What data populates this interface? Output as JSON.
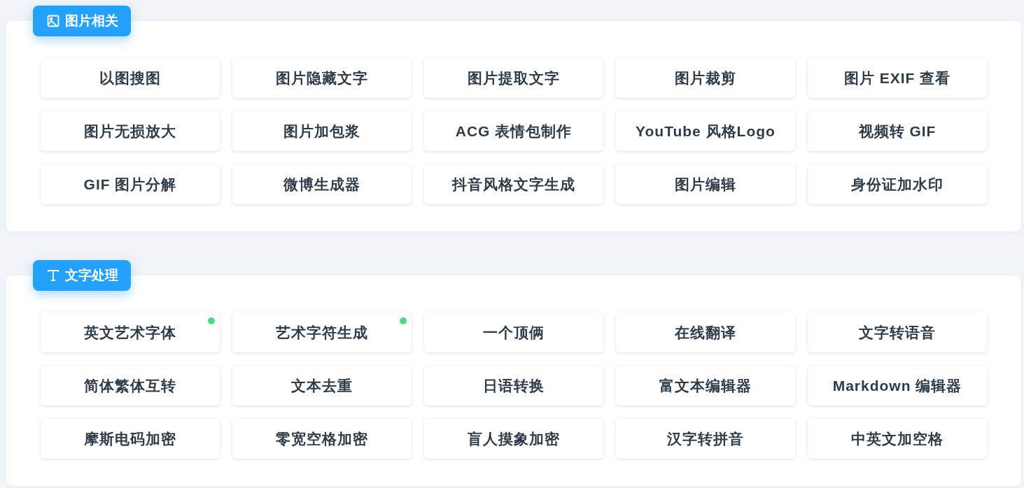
{
  "sections": [
    {
      "title": "图片相关",
      "kind": "image",
      "tools": [
        {
          "label": "以图搜图",
          "is_new": false
        },
        {
          "label": "图片隐藏文字",
          "is_new": false
        },
        {
          "label": "图片提取文字",
          "is_new": false
        },
        {
          "label": "图片裁剪",
          "is_new": false
        },
        {
          "label": "图片 EXIF 查看",
          "is_new": false
        },
        {
          "label": "图片无损放大",
          "is_new": false
        },
        {
          "label": "图片加包浆",
          "is_new": false
        },
        {
          "label": "ACG 表情包制作",
          "is_new": false
        },
        {
          "label": "YouTube 风格Logo",
          "is_new": false
        },
        {
          "label": "视频转 GIF",
          "is_new": false
        },
        {
          "label": "GIF 图片分解",
          "is_new": false
        },
        {
          "label": "微博生成器",
          "is_new": false
        },
        {
          "label": "抖音风格文字生成",
          "is_new": false
        },
        {
          "label": "图片编辑",
          "is_new": false
        },
        {
          "label": "身份证加水印",
          "is_new": false
        }
      ]
    },
    {
      "title": "文字处理",
      "kind": "text",
      "tools": [
        {
          "label": "英文艺术字体",
          "is_new": true
        },
        {
          "label": "艺术字符生成",
          "is_new": true
        },
        {
          "label": "一个顶俩",
          "is_new": false
        },
        {
          "label": "在线翻译",
          "is_new": false
        },
        {
          "label": "文字转语音",
          "is_new": false
        },
        {
          "label": "简体繁体互转",
          "is_new": false
        },
        {
          "label": "文本去重",
          "is_new": false
        },
        {
          "label": "日语转换",
          "is_new": false
        },
        {
          "label": "富文本编辑器",
          "is_new": false
        },
        {
          "label": "Markdown 编辑器",
          "is_new": false
        },
        {
          "label": "摩斯电码加密",
          "is_new": false
        },
        {
          "label": "零宽空格加密",
          "is_new": false
        },
        {
          "label": "盲人摸象加密",
          "is_new": false
        },
        {
          "label": "汉字转拼音",
          "is_new": false
        },
        {
          "label": "中英文加空格",
          "is_new": false
        }
      ]
    }
  ]
}
